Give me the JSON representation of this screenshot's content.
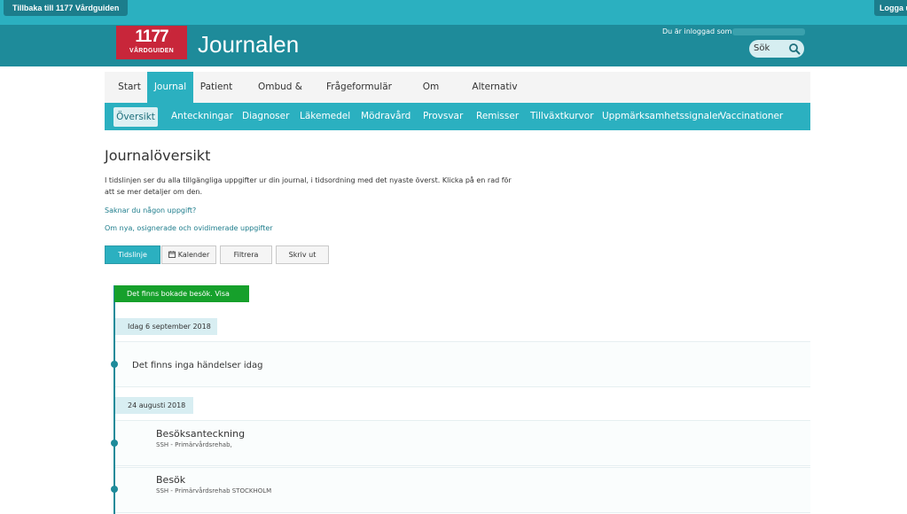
{
  "topbar": {
    "back_label": "Tillbaka till 1177 Vårdguiden",
    "logout_label": "Logga ut"
  },
  "header": {
    "logo_number": "1177",
    "logo_text": "VÅRDGUIDEN",
    "title": "Journalen",
    "logged_in_label": "Du är inloggad som:",
    "search_placeholder": "Sök",
    "brand_color": "#1e8b9a",
    "accent_color": "#2bb0c0",
    "logo_color": "#c8263a"
  },
  "main_nav": {
    "items": [
      {
        "label": "Start"
      },
      {
        "label": "Journal"
      },
      {
        "label": "Patient"
      },
      {
        "label": "Ombud & loggar"
      },
      {
        "label": "Frågeformulär"
      },
      {
        "label": "Om Journalen"
      },
      {
        "label": "Alternativ"
      }
    ],
    "active": "Journal"
  },
  "sub_nav": {
    "items": [
      {
        "label": "Översikt"
      },
      {
        "label": "Anteckningar"
      },
      {
        "label": "Diagnoser"
      },
      {
        "label": "Läkemedel"
      },
      {
        "label": "Mödravård"
      },
      {
        "label": "Provsvar"
      },
      {
        "label": "Remisser"
      },
      {
        "label": "Tillväxtkurvor"
      },
      {
        "label": "Uppmärksamhetssignaler"
      },
      {
        "label": "Vaccinationer"
      }
    ],
    "active": "Översikt"
  },
  "content": {
    "title": "Journalöversikt",
    "intro": "I tidslinjen ser du alla tillgängliga uppgifter ur din journal, i tidsordning med det nyaste överst. Klicka på en rad för att se mer detaljer om den.",
    "link_missing": "Saknar du någon uppgift?",
    "link_new": "Om nya, osignerade och ovidimerade uppgifter",
    "buttons": {
      "timeline": "Tidslinje",
      "calendar": "Kalender",
      "filter": "Filtrera",
      "print": "Skriv ut"
    }
  },
  "timeline": {
    "booked_notice": "Det finns bokade besök. Visa",
    "groups": [
      {
        "date": "Idag 6 september 2018",
        "entries": [
          {
            "text": "Det finns inga händelser idag"
          }
        ]
      },
      {
        "date": "24 augusti 2018",
        "entries": [
          {
            "title": "Besöksanteckning",
            "subtitle": "SSH - Primärvårdsrehab,"
          },
          {
            "title": "Besök",
            "subtitle": "SSH - Primärvårdsrehab STOCKHOLM"
          }
        ]
      }
    ],
    "booked_color": "#16a02b"
  }
}
